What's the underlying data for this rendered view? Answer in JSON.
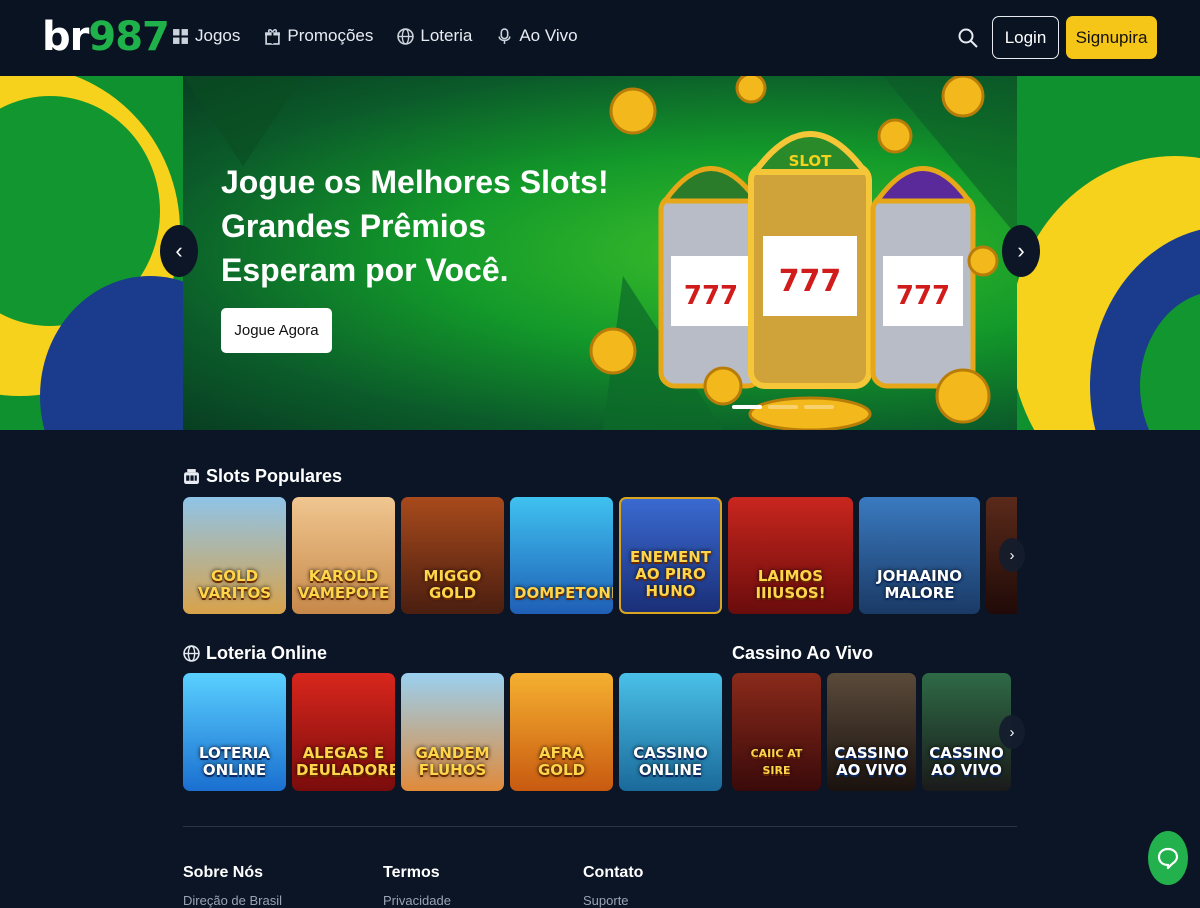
{
  "brand": {
    "logo_part1": "br",
    "logo_part2": "987"
  },
  "nav": [
    {
      "label": "Jogos",
      "icon": "grid-icon"
    },
    {
      "label": "Promoções",
      "icon": "gift-icon"
    },
    {
      "label": "Loteria",
      "icon": "globe-icon"
    },
    {
      "label": "Ao Vivo",
      "icon": "microphone-icon"
    }
  ],
  "header": {
    "login_label": "Login",
    "signup_label": "Signupira"
  },
  "hero": {
    "headline_line1": "Jogue os Melhores Slots!",
    "headline_line2": "Grandes Prêmios",
    "headline_line3": "Esperam por Você.",
    "cta_label": "Jogue Agora",
    "prev_glyph": "‹",
    "next_glyph": "›",
    "slide_count": 3,
    "active_slide": 1
  },
  "sections": {
    "slots_title": "Slots Populares",
    "loteria_title": "Loteria Online",
    "cassino_title": "Cassino Ao Vivo",
    "row_arrow_glyph": "›"
  },
  "slots": [
    {
      "name": "GOLD VARITOS",
      "bg": "#d8a24a"
    },
    {
      "name": "KAROLD VAMEPOTE",
      "bg": "#c7894a"
    },
    {
      "name": "MIGGO GOLD",
      "bg": "#7a3a1e"
    },
    {
      "name": "DOMPETONES",
      "bg": "#1f8fd6"
    },
    {
      "name": "ENEMENT AO PIRO HUNO",
      "bg": "#2b4fa8"
    },
    {
      "name": "LAIMOS IIIUSOS!",
      "bg": "#a81a1a"
    },
    {
      "name": "JOHAAINO MALORE",
      "bg": "#2a62a0"
    },
    {
      "name": "",
      "bg": "#3a1a14"
    }
  ],
  "loteria": [
    {
      "name": "LOTERIA ONLINE",
      "bg": "#1f8fe0"
    },
    {
      "name": "ALEGAS E DEULADORES",
      "bg": "#b5171a"
    },
    {
      "name": "GANDEM FLUHOS",
      "bg": "#e79a3a"
    },
    {
      "name": "AFRA GOLD",
      "bg": "#e88a15"
    },
    {
      "name": "CASSINO ONLINE",
      "bg": "#1c8fcf"
    }
  ],
  "cassino": [
    {
      "name": "CAIIC AT SIRE",
      "bg": "#6a1414"
    },
    {
      "name": "CASSINO AO VIVO",
      "bg": "#3a2a22"
    },
    {
      "name": "CASSINO AO VIVO",
      "bg": "#2e4a36"
    }
  ],
  "footer": {
    "col1_title": "Sobre Nós",
    "col1_link": "Direção de Brasil",
    "col2_title": "Termos",
    "col2_link": "Privacidade",
    "col3_title": "Contato",
    "col3_link": "Suporte"
  },
  "colors": {
    "accent_green": "#1fb24a",
    "accent_yellow": "#f5c518",
    "background": "#0b1526"
  }
}
